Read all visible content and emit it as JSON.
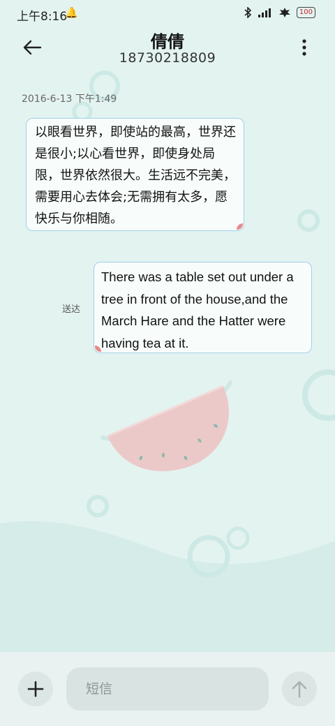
{
  "status_bar": {
    "time": "上午8:16",
    "bell_glyph": "🔔",
    "icons": [
      "bluetooth-icon",
      "signal-icon",
      "leaf-icon"
    ],
    "battery": "100"
  },
  "header": {
    "contact_name": "倩倩",
    "contact_number": "18730218809",
    "back_icon": "arrow-left-icon",
    "more_icon": "more-vertical-icon"
  },
  "conversation": {
    "timestamp": "2016-6-13 下午1:49",
    "incoming_message": "以眼看世界，即使站的最高，世界还是很小;以心看世界，即使身处局限，世界依然很大。生活远不完美，需要用心去体会;无需拥有太多，愿快乐与你相随。",
    "outgoing_message": "There was a table set out under a tree in front of the house,and the March Hare and the Hatter were having tea at it.",
    "delivered_status": "送达"
  },
  "composer": {
    "placeholder": "短信",
    "add_icon": "plus-icon",
    "send_icon": "arrow-up-icon"
  },
  "colors": {
    "background": "#e3f3f0",
    "bubble_border": "#9fd0e8",
    "watermelon_flesh": "#ecc9c9",
    "accent_pink": "#e98a8a"
  }
}
